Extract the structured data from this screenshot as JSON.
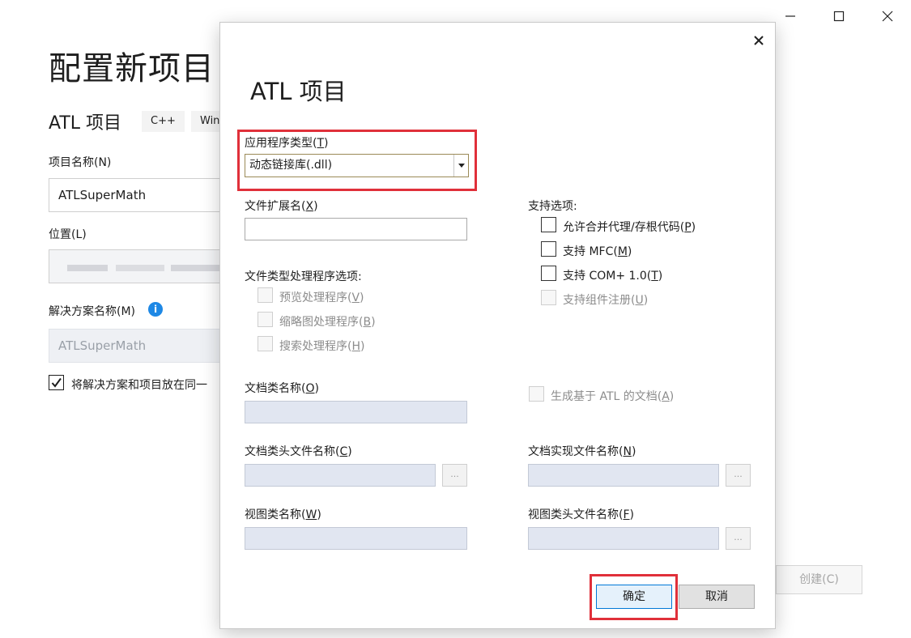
{
  "window": {
    "minimize_icon": "minimize-icon",
    "maximize_icon": "maximize-icon",
    "close_icon": "close-icon"
  },
  "background": {
    "title": "配置新项目",
    "subtitle": "ATL 项目",
    "tags": [
      "C++",
      "Win"
    ],
    "project_name_label": "项目名称(N)",
    "project_name_value": "ATLSuperMath",
    "location_label": "位置(L)",
    "solution_name_label": "解决方案名称(M)",
    "solution_name_value": "ATLSuperMath",
    "same_dir_label": "将解决方案和项目放在同一",
    "create_button": "创建(C)"
  },
  "dialog": {
    "title": "ATL 项目",
    "app_type": {
      "label_main": "应用程序类型(",
      "label_key": "T",
      "label_end": ")",
      "selected": "动态链接库(.dll)"
    },
    "file_ext": {
      "label_main": "文件扩展名(",
      "label_key": "X",
      "label_end": ")",
      "value": ""
    },
    "support_options": {
      "label": "支持选项:",
      "items": [
        {
          "main": "允许合并代理/存根代码(",
          "key": "P",
          "end": ")",
          "checked": false,
          "enabled": true
        },
        {
          "main": "支持 MFC(",
          "key": "M",
          "end": ")",
          "checked": false,
          "enabled": true
        },
        {
          "main": "支持 COM+ 1.0(",
          "key": "T",
          "end": ")",
          "checked": false,
          "enabled": true
        },
        {
          "main": "支持组件注册(",
          "key": "U",
          "end": ")",
          "checked": false,
          "enabled": false
        }
      ]
    },
    "handler_options": {
      "label": "文件类型处理程序选项:",
      "items": [
        {
          "main": "预览处理程序(",
          "key": "V",
          "end": ")"
        },
        {
          "main": "缩略图处理程序(",
          "key": "B",
          "end": ")"
        },
        {
          "main": "搜索处理程序(",
          "key": "H",
          "end": ")"
        }
      ]
    },
    "doc_class_name": {
      "main": "文档类名称(",
      "key": "O",
      "end": ")"
    },
    "generate_doc": {
      "main": "生成基于 ATL 的文档(",
      "key": "A",
      "end": ")"
    },
    "doc_header": {
      "main": "文档类头文件名称(",
      "key": "C",
      "end": ")"
    },
    "doc_impl": {
      "main": "文档实现文件名称(",
      "key": "N",
      "end": ")"
    },
    "view_class": {
      "main": "视图类名称(",
      "key": "W",
      "end": ")"
    },
    "view_header": {
      "main": "视图类头文件名称(",
      "key": "F",
      "end": ")"
    },
    "browse_label": "...",
    "ok_button": "确定",
    "cancel_button": "取消"
  },
  "colors": {
    "highlight": "#e0303a",
    "accent": "#0078d7",
    "disabled_field": "#e1e6f1"
  }
}
